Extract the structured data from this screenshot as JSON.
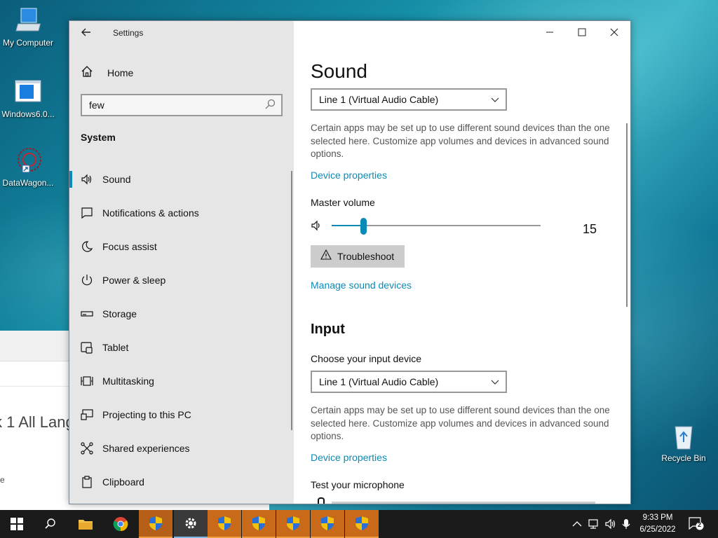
{
  "desktop": {
    "icons": [
      {
        "label": "My Computer"
      },
      {
        "label": "Windows6.0..."
      },
      {
        "label": "DataWagon..."
      },
      {
        "label": "Recycle Bin"
      }
    ],
    "background_window": {
      "text_large": "k 1 All Lang",
      "text_small": "e"
    }
  },
  "settings": {
    "title": "Settings",
    "sidebar": {
      "home_label": "Home",
      "search_value": "few",
      "section_heading": "System",
      "items": [
        {
          "label": "Sound",
          "icon": "speaker-icon",
          "active": true
        },
        {
          "label": "Notifications & actions",
          "icon": "message-icon"
        },
        {
          "label": "Focus assist",
          "icon": "moon-icon"
        },
        {
          "label": "Power & sleep",
          "icon": "power-icon"
        },
        {
          "label": "Storage",
          "icon": "storage-icon"
        },
        {
          "label": "Tablet",
          "icon": "tablet-icon"
        },
        {
          "label": "Multitasking",
          "icon": "multitasking-icon"
        },
        {
          "label": "Projecting to this PC",
          "icon": "projecting-icon"
        },
        {
          "label": "Shared experiences",
          "icon": "shared-icon"
        },
        {
          "label": "Clipboard",
          "icon": "clipboard-icon"
        }
      ]
    },
    "main": {
      "heading": "Sound",
      "output_device": "Line 1 (Virtual Audio Cable)",
      "output_description": "Certain apps may be set up to use different sound devices than the one selected here. Customize app volumes and devices in advanced sound options.",
      "output_device_properties_link": "Device properties",
      "master_volume_label": "Master volume",
      "master_volume_value": "15",
      "master_volume_level": 0.15,
      "troubleshoot_label": "Troubleshoot",
      "manage_devices_link": "Manage sound devices",
      "input_heading": "Input",
      "input_choose_label": "Choose your input device",
      "input_device": "Line 1 (Virtual Audio Cable)",
      "input_description": "Certain apps may be set up to use different sound devices than the one selected here. Customize app volumes and devices in advanced sound options.",
      "input_device_properties_link": "Device properties",
      "test_mic_label": "Test your microphone"
    }
  },
  "taskbar": {
    "clock_time": "9:33 PM",
    "clock_date": "6/25/2022",
    "notification_count": "2"
  },
  "colors": {
    "accent": "#0a8bb5",
    "taskbar": "#1b1b1b",
    "sidebar": "#e6e6e6"
  }
}
